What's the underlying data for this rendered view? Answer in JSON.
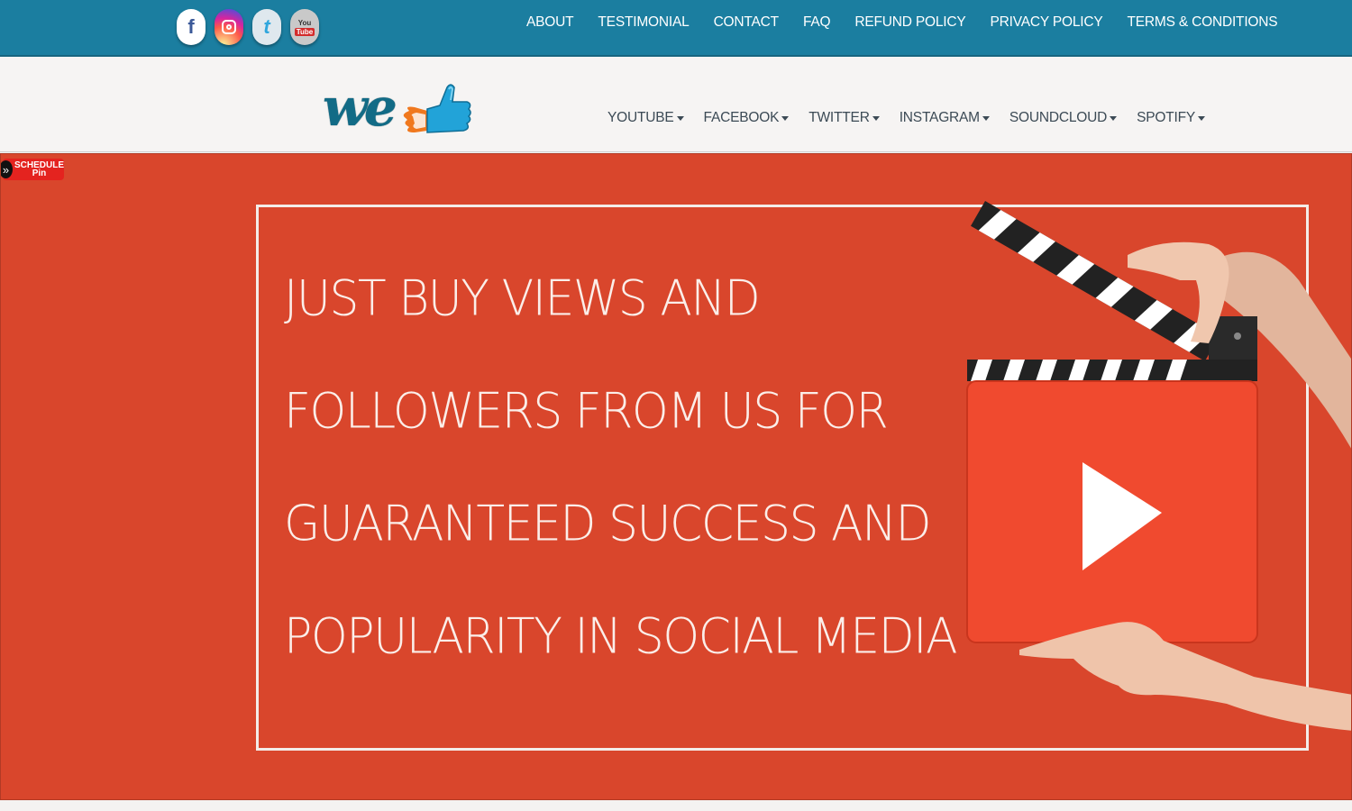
{
  "topbar": {
    "social": [
      {
        "name": "facebook-icon",
        "glyph": "f"
      },
      {
        "name": "instagram-icon",
        "glyph": ""
      },
      {
        "name": "twitter-icon",
        "glyph": "t"
      },
      {
        "name": "youtube-icon",
        "glyph_top": "You",
        "glyph_bottom": "Tube"
      }
    ],
    "links": [
      "ABOUT",
      "TESTIMONIAL",
      "CONTACT",
      "FAQ",
      "REFUND POLICY",
      "PRIVACY POLICY",
      "TERMS & CONDITIONS"
    ]
  },
  "header": {
    "logo_text": "we",
    "nav": [
      "YOUTUBE",
      "FACEBOOK",
      "TWITTER",
      "INSTAGRAM",
      "SOUNDCLOUD",
      "SPOTIFY"
    ]
  },
  "hero": {
    "headline": [
      "JUST BUY VIEWS AND",
      "FOLLOWERS FROM US FOR",
      "GUARANTEED SUCCESS AND",
      "POPULARITY IN SOCIAL MEDIA"
    ],
    "schedule_pin": {
      "line1": "SCHEDULE",
      "line2": "Pin",
      "arrow": "»"
    }
  },
  "colors": {
    "topbar": "#1b7ea0",
    "hero_bg": "#d9462c",
    "clapper_red": "#f04a2f"
  }
}
